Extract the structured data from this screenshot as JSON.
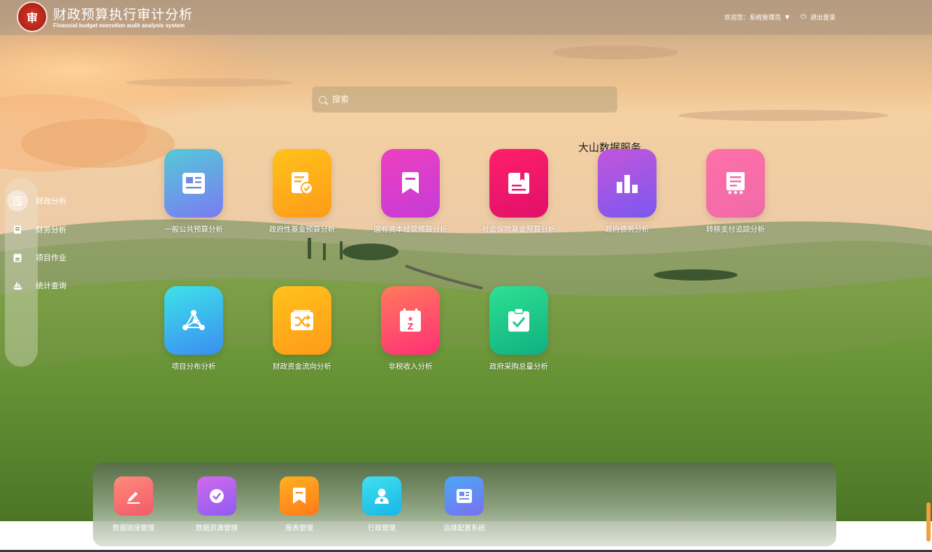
{
  "header": {
    "title": "财政预算执行审计分析",
    "subtitle": "Financial budget execution audit analysis system",
    "welcome": "欢迎您：系统管理员",
    "logout": "退出登录"
  },
  "search": {
    "placeholder": "搜索"
  },
  "floating_label": "大山数据服务",
  "sidebar": {
    "items": [
      {
        "label": "财政分析",
        "icon": "ledger-icon",
        "active": true
      },
      {
        "label": "财务分析",
        "icon": "receipt-icon",
        "active": false
      },
      {
        "label": "项目作业",
        "icon": "calendar-icon",
        "active": false
      },
      {
        "label": "统计查询",
        "icon": "sailboat-icon",
        "active": false
      }
    ]
  },
  "tiles": [
    {
      "label": "一般公共预算分析",
      "icon": "newspaper-icon",
      "colors": [
        "#55c9d8",
        "#7a7bf2"
      ]
    },
    {
      "label": "政府性基金预算分析",
      "icon": "document-check-icon",
      "colors": [
        "#ffc21a",
        "#ff9a1a"
      ]
    },
    {
      "label": "国有资本经营预算分析",
      "icon": "bookmark-icon",
      "colors": [
        "#ec40c0",
        "#c63bd6"
      ]
    },
    {
      "label": "社会保险基金预算分析",
      "icon": "book-icon",
      "colors": [
        "#ff1f6a",
        "#e0106a"
      ]
    },
    {
      "label": "政府债务分析",
      "icon": "bar-chart-icon",
      "colors": [
        "#c455dc",
        "#7a58ee"
      ]
    },
    {
      "label": "转移支付追踪分析",
      "icon": "certificate-icon",
      "colors": [
        "#ff70a8",
        "#f06aa8"
      ]
    },
    {
      "label": "项目分布分析",
      "icon": "network-icon",
      "colors": [
        "#3ee2e8",
        "#3a8ef2"
      ]
    },
    {
      "label": "财政资金流向分析",
      "icon": "shuffle-icon",
      "colors": [
        "#ffc21a",
        "#ff9a1a"
      ]
    },
    {
      "label": "非税收入分析",
      "icon": "tax-icon",
      "colors": [
        "#ff7a5c",
        "#ff2f76"
      ]
    },
    {
      "label": "政府采购总量分析",
      "icon": "clipboard-check-icon",
      "colors": [
        "#2ee093",
        "#10b080"
      ]
    }
  ],
  "dock": [
    {
      "label": "数据链接管理",
      "icon": "pencil-icon",
      "colors": [
        "#ff8a7a",
        "#f25a6a"
      ]
    },
    {
      "label": "数据资源管理",
      "icon": "check-circle-icon",
      "colors": [
        "#d06aee",
        "#8e5cf0"
      ]
    },
    {
      "label": "报表管理",
      "icon": "bookmark-icon",
      "colors": [
        "#ffb020",
        "#ff7a1a"
      ]
    },
    {
      "label": "行政管理",
      "icon": "user-badge-icon",
      "colors": [
        "#40e0f0",
        "#18b6e6"
      ]
    },
    {
      "label": "运维配置系统",
      "icon": "newspaper-icon",
      "colors": [
        "#4aa8f6",
        "#7a70f0"
      ]
    }
  ]
}
